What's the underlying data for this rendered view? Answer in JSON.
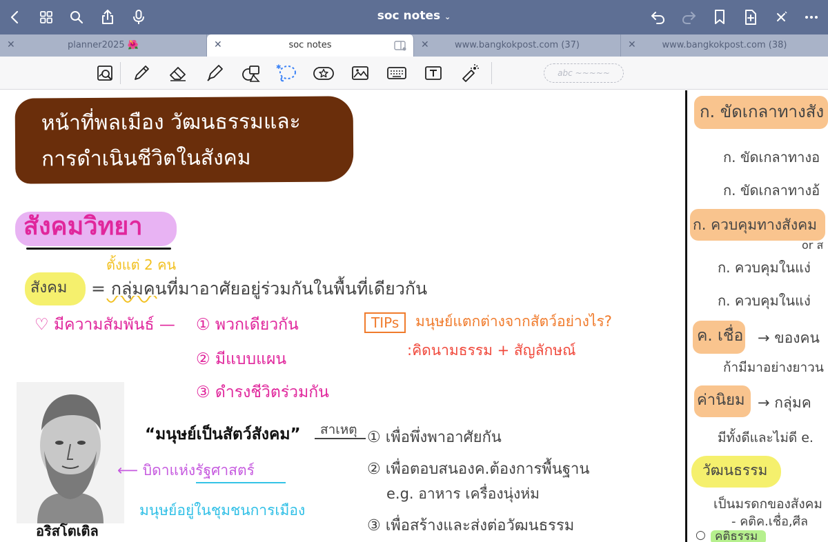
{
  "topbar": {
    "title": "soc notes",
    "icons": [
      "back-chevron-icon",
      "grid-icon",
      "search-icon",
      "share-icon",
      "microphone-icon",
      "undo-icon",
      "redo-icon",
      "bookmark-icon",
      "add-page-icon",
      "close-x-icon",
      "more-dots-icon"
    ]
  },
  "tabs": [
    {
      "label": "planner2025 🌺",
      "active": false
    },
    {
      "label": "soc notes",
      "active": true
    },
    {
      "label": "www.bangkokpost.com (37)",
      "active": false
    },
    {
      "label": "www.bangkokpost.com (38)",
      "active": false
    }
  ],
  "toolbar": {
    "tools": [
      "zoom-box-icon",
      "pen-icon",
      "eraser-icon",
      "highlighter-icon",
      "shapes-icon",
      "lasso-icon",
      "sticker-icon",
      "image-icon",
      "keyboard-icon",
      "text-box-icon",
      "laser-pointer-icon"
    ],
    "text_placeholder": "abc ~~~~~"
  },
  "note_left": {
    "banner_line1": "หน้าที่พลเมือง วัฒนธรรมและ",
    "banner_line2": "การดำเนินชีวิตในสังคม",
    "heading": "สังคมวิทยา",
    "yellow_note": "ตั้งแต่ 2 คน",
    "term": "สังคม",
    "definition": "= กลุ่มคนที่มาอาศัยอยู่ร่วมกันในพื้นที่เดียวกัน",
    "relation": "♡ มีความสัมพันธ์ —",
    "point1": "① พวกเดียวกัน",
    "point2": "② มีแบบแผน",
    "point3": "③ ดำรงชีวิตร่วมกัน",
    "tips_label": "TIPs",
    "tips_question": "มนุษย์แตกต่างจากสัตว์อย่างไร?",
    "tips_answer": ":คิดนามธรรม + สัญลักษณ์",
    "quote": "“มนุษย์เป็นสัตว์สังคม”",
    "cause_label": "สาเหตุ",
    "cause1": "① เพื่อพึ่งพาอาศัยกัน",
    "cause2": "② เพื่อตอบสนองค.ต้องการพื้นฐาน",
    "cause2_eg": "e.g. อาหาร เครื่องนุ่งห่ม",
    "cause3": "③ เพื่อสร้างและส่งต่อวัฒนธรรม",
    "father": "⟵ บิดาแห่งรัฐศาสตร์",
    "polis": "มนุษย์อยู่ในชุมชนการเมือง",
    "portrait_name": "อริสโตเติล"
  },
  "note_right": {
    "r1": "ก. ขัดเกลาทางสัง",
    "r2": "ก. ขัดเกลาทางอ",
    "r3": "ก. ขัดเกลาทางอ้",
    "r4": "ก. ควบคุมทางสังคม",
    "r4b": "or ส",
    "r5": "ก. ควบคุมในแง่",
    "r6": "ก. ควบคุมในแง่",
    "r7": "ค. เชื่อ",
    "r7b": "→ ของคน",
    "r8": "ก้ามีมาอย่างยาวน",
    "r9": "ค่านิยม",
    "r9b": "→ กลุ่มค",
    "r10": "มีทั้งดีและไม่ดี e.",
    "r11": "วัฒนธรรม",
    "r12": "เป็นมรดกของสังคม",
    "r13": "- คติค.เชื่อ,ศีล",
    "r14": "คติธรรม"
  }
}
